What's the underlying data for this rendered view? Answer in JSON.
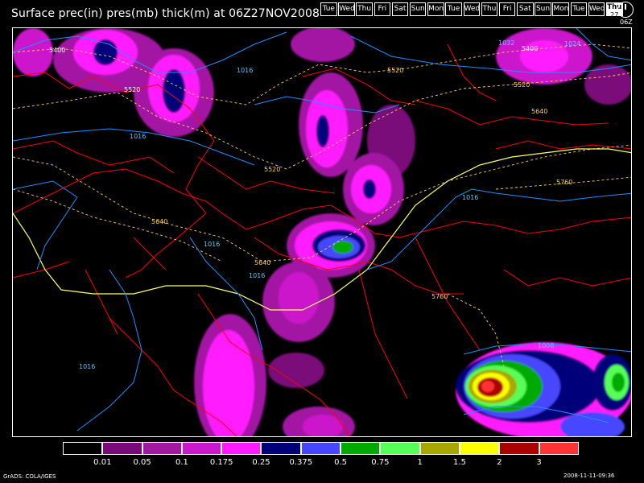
{
  "title": "Surface prec(in) pres(mb) thick(m) at 06Z27NOV2008",
  "day_strip": [
    "Tue",
    "Wed",
    "Thu",
    "Fri",
    "Sat",
    "Sun",
    "Mon",
    "Tue",
    "Wed",
    "Thu",
    "Fri",
    "Sat",
    "Sun",
    "Mon",
    "Tue",
    "Wed"
  ],
  "current_day": {
    "name": "Thu",
    "date": "27"
  },
  "clock_label": "06Z",
  "legend": {
    "colors": [
      "#000000",
      "#7a0a7a",
      "#a317a3",
      "#cc18cc",
      "#ff1bff",
      "#00007a",
      "#4646ff",
      "#00aa00",
      "#55ff55",
      "#a7a700",
      "#ffff00",
      "#aa0000",
      "#ff3333"
    ],
    "labels": [
      "0.01",
      "0.05",
      "0.1",
      "0.175",
      "0.25",
      "0.375",
      "0.5",
      "0.75",
      "1",
      "1.5",
      "2",
      "3"
    ]
  },
  "isobar_labels": [
    "1016",
    "1016",
    "1016",
    "1016",
    "1016",
    "1016",
    "1032",
    "1024",
    "1008"
  ],
  "thickness_labels": [
    "5400",
    "5520",
    "5520",
    "5520",
    "5400",
    "5520",
    "5640",
    "5640",
    "5640",
    "5760",
    "5760"
  ],
  "colors": {
    "isobar": "#1e90ff",
    "thickness": "#ffd24a",
    "border": "#ff0000",
    "contour_5640": "#ffff66"
  },
  "credit": "GrADS: COLA/IGES",
  "timestamp": "2008-11-11-09:36"
}
